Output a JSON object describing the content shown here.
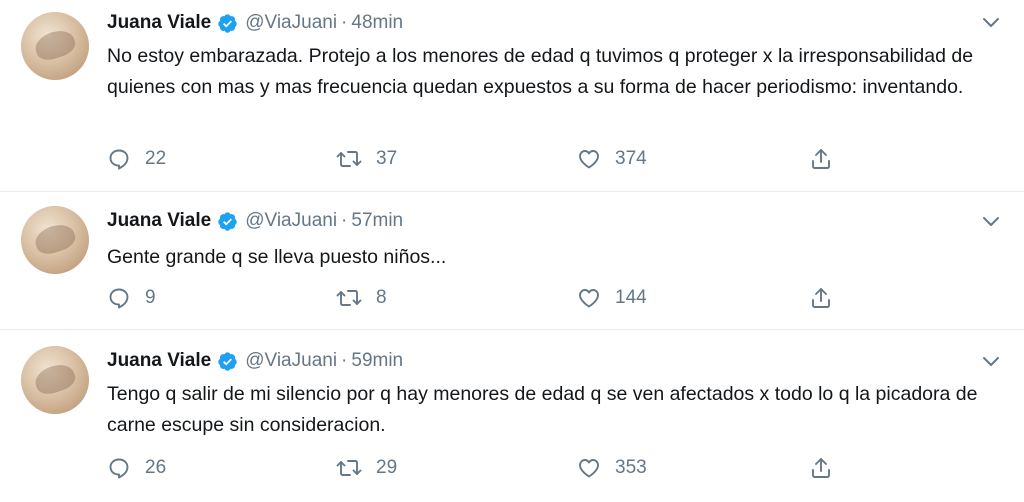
{
  "tweets": [
    {
      "name": "Juana Viale",
      "handle": "@ViaJuani",
      "dot": "·",
      "time": "48min",
      "text": "No estoy embarazada. Protejo a los menores de edad q tuvimos q proteger x la irresponsabilidad de quienes con mas y mas frecuencia quedan expuestos a su forma de hacer periodismo: inventando.",
      "replies": "22",
      "retweets": "37",
      "likes": "374"
    },
    {
      "name": "Juana Viale",
      "handle": "@ViaJuani",
      "dot": "·",
      "time": "57min",
      "text": "Gente grande q se lleva puesto niños...",
      "replies": "9",
      "retweets": "8",
      "likes": "144"
    },
    {
      "name": "Juana Viale",
      "handle": "@ViaJuani",
      "dot": "·",
      "time": "59min",
      "text": "Tengo q salir de mi silencio por q hay menores de edad q se ven afectados x todo lo q la picadora de carne escupe sin consideracion.",
      "replies": "26",
      "retweets": "29",
      "likes": "353"
    }
  ],
  "icons": {
    "reply": "reply-icon",
    "retweet": "retweet-icon",
    "like": "heart-icon",
    "share": "share-icon",
    "verified": "verified-badge-icon",
    "menu": "chevron-down-icon"
  },
  "colors": {
    "text": "#14171a",
    "secondary": "#657786",
    "verified": "#1da1f2",
    "divider": "#e6ecf0"
  }
}
